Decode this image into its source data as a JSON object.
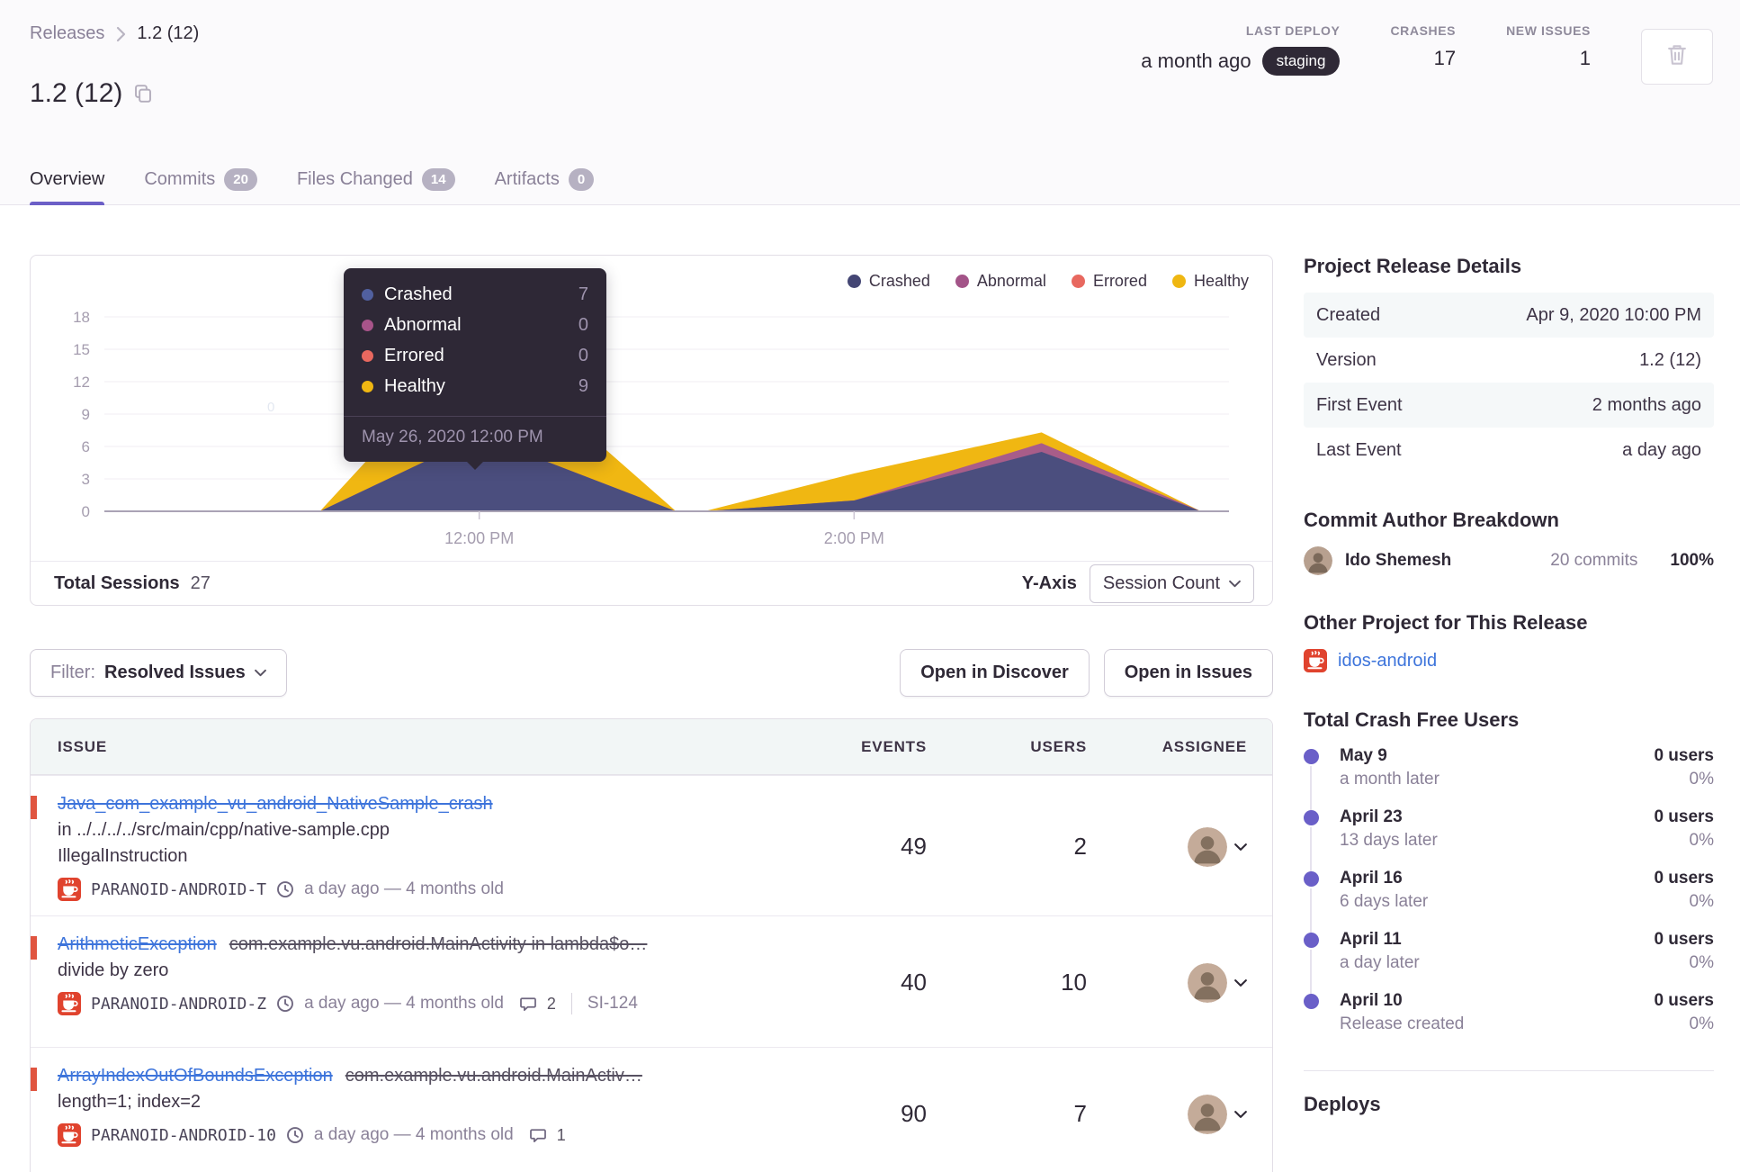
{
  "breadcrumb": {
    "parent": "Releases",
    "current": "1.2 (12)"
  },
  "page_title": "1.2 (12)",
  "header_stats": {
    "last_deploy": {
      "label": "LAST DEPLOY",
      "value": "a month ago",
      "env": "staging"
    },
    "crashes": {
      "label": "CRASHES",
      "value": "17"
    },
    "new_issues": {
      "label": "NEW ISSUES",
      "value": "1"
    }
  },
  "tabs": {
    "overview": {
      "label": "Overview"
    },
    "commits": {
      "label": "Commits",
      "count": "20"
    },
    "files_changed": {
      "label": "Files Changed",
      "count": "14"
    },
    "artifacts": {
      "label": "Artifacts",
      "count": "0"
    }
  },
  "chart": {
    "watermark": "0",
    "legend": [
      {
        "label": "Crashed",
        "color": "#444674"
      },
      {
        "label": "Abnormal",
        "color": "#a35488"
      },
      {
        "label": "Errored",
        "color": "#e8685f"
      },
      {
        "label": "Healthy",
        "color": "#efb712"
      }
    ],
    "tooltip": {
      "rows": [
        {
          "label": "Crashed",
          "value": "7",
          "color": "#51609f"
        },
        {
          "label": "Abnormal",
          "value": "0",
          "color": "#a8548a"
        },
        {
          "label": "Errored",
          "value": "0",
          "color": "#e8685f"
        },
        {
          "label": "Healthy",
          "value": "9",
          "color": "#f0b712"
        }
      ],
      "date": "May 26, 2020 12:00 PM"
    },
    "footer": {
      "total_label": "Total Sessions",
      "total_value": "27",
      "yaxis_label": "Y-Axis",
      "yaxis_value": "Session Count"
    }
  },
  "chart_data": {
    "type": "area-stacked",
    "title": "Sessions by status over time",
    "x_axis": {
      "range_hours": [
        10,
        16
      ],
      "ticks": [
        {
          "hour": 12,
          "label": "12:00 PM"
        },
        {
          "hour": 14,
          "label": "2:00 PM"
        }
      ]
    },
    "y_axis": {
      "min": 0,
      "max": 18,
      "ticks": [
        0,
        3,
        6,
        9,
        12,
        15,
        18
      ]
    },
    "x_hours": [
      10,
      11.15,
      12,
      13.05,
      13.2,
      14,
      15,
      15.85,
      16
    ],
    "series": [
      {
        "name": "Crashed",
        "color": "#4b4e7e",
        "values": [
          0,
          0,
          7,
          0,
          0,
          1,
          5.5,
          0,
          0
        ]
      },
      {
        "name": "Abnormal",
        "color": "#a85d89",
        "values": [
          0,
          0,
          0,
          0,
          0,
          0,
          0.8,
          0,
          0
        ]
      },
      {
        "name": "Errored",
        "color": "#e8685f",
        "values": [
          0,
          0,
          0,
          0,
          0,
          0,
          0,
          0,
          0
        ]
      },
      {
        "name": "Healthy",
        "color": "#f0b712",
        "values": [
          0,
          0,
          9,
          0,
          0,
          2.5,
          1,
          0,
          0
        ]
      }
    ],
    "hover_point": {
      "date": "May 26, 2020 12:00 PM",
      "crashed": 7,
      "abnormal": 0,
      "errored": 0,
      "healthy": 9
    },
    "total_sessions": 27,
    "legend_position": "top-right",
    "grid": true
  },
  "filter_bar": {
    "filter_label": "Filter:",
    "filter_value": "Resolved Issues",
    "open_discover": "Open in Discover",
    "open_issues": "Open in Issues"
  },
  "issues": {
    "columns": {
      "issue": "ISSUE",
      "events": "EVENTS",
      "users": "USERS",
      "assignee": "ASSIGNEE"
    },
    "rows": [
      {
        "title": "Java_com_example_vu_android_NativeSample_crash",
        "subtitle": "",
        "line2": "in ../../../../src/main/cpp/native-sample.cpp",
        "line3": "IllegalInstruction",
        "project": "PARANOID-ANDROID-T",
        "age": "a day ago — 4 months old",
        "comments": "",
        "ticket": "",
        "events": "49",
        "users": "2"
      },
      {
        "title": "ArithmeticException",
        "subtitle": "com.example.vu.android.MainActivity in lambda$o…",
        "line2": "divide by zero",
        "line3": "",
        "project": "PARANOID-ANDROID-Z",
        "age": "a day ago — 4 months old",
        "comments": "2",
        "ticket": "SI-124",
        "events": "40",
        "users": "10"
      },
      {
        "title": "ArrayIndexOutOfBoundsException",
        "subtitle": "com.example.vu.android.MainActiv…",
        "line2": "length=1; index=2",
        "line3": "",
        "project": "PARANOID-ANDROID-10",
        "age": "a day ago — 4 months old",
        "comments": "1",
        "ticket": "",
        "events": "90",
        "users": "7"
      }
    ]
  },
  "sidebar": {
    "details": {
      "title": "Project Release Details",
      "rows": [
        {
          "label": "Created",
          "value": "Apr 9, 2020 10:00 PM"
        },
        {
          "label": "Version",
          "value": "1.2 (12)"
        },
        {
          "label": "First Event",
          "value": "2 months ago"
        },
        {
          "label": "Last Event",
          "value": "a day ago"
        }
      ]
    },
    "commit_breakdown": {
      "title": "Commit Author Breakdown",
      "author": "Ido Shemesh",
      "commits": "20 commits",
      "percent": "100%"
    },
    "other_project": {
      "title": "Other Project for This Release",
      "project": "idos-android"
    },
    "crash_free": {
      "title": "Total Crash Free Users",
      "entries": [
        {
          "date": "May 9",
          "sub": "a month later",
          "users": "0 users",
          "pct": "0%"
        },
        {
          "date": "April 23",
          "sub": "13 days later",
          "users": "0 users",
          "pct": "0%"
        },
        {
          "date": "April 16",
          "sub": "6 days later",
          "users": "0 users",
          "pct": "0%"
        },
        {
          "date": "April 11",
          "sub": "a day later",
          "users": "0 users",
          "pct": "0%"
        },
        {
          "date": "April 10",
          "sub": "Release created",
          "users": "0 users",
          "pct": "0%"
        }
      ]
    },
    "deploys": {
      "title": "Deploys"
    }
  }
}
